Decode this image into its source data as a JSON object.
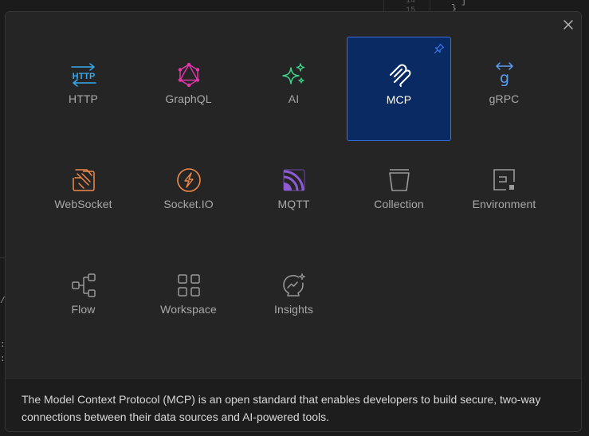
{
  "background": {
    "line_numbers": [
      "14",
      "15"
    ],
    "code_lines": [
      "]",
      "}"
    ],
    "left_marks": [
      ":",
      ":",
      "/"
    ]
  },
  "modal": {
    "close_label": "×",
    "tiles": [
      {
        "label": "HTTP",
        "icon": "http-icon",
        "color": "#3aa8e8"
      },
      {
        "label": "GraphQL",
        "icon": "graphql-icon",
        "color": "#e535ab"
      },
      {
        "label": "AI",
        "icon": "sparkles-icon",
        "color": "#3dd68c"
      },
      {
        "label": "MCP",
        "icon": "mcp-icon",
        "color": "#ffffff",
        "active": true
      },
      {
        "label": "gRPC",
        "icon": "grpc-icon",
        "color": "#5b9df5"
      },
      {
        "label": "WebSocket",
        "icon": "websocket-icon",
        "color": "#f08a4b"
      },
      {
        "label": "Socket.IO",
        "icon": "socketio-icon",
        "color": "#f08a4b"
      },
      {
        "label": "MQTT",
        "icon": "mqtt-icon",
        "color": "#8f5bd4"
      },
      {
        "label": "Collection",
        "icon": "collection-icon",
        "color": "#9a9a9a"
      },
      {
        "label": "Environment",
        "icon": "environment-icon",
        "color": "#9a9a9a"
      },
      {
        "label": "Flow",
        "icon": "flow-icon",
        "color": "#9a9a9a"
      },
      {
        "label": "Workspace",
        "icon": "workspace-icon",
        "color": "#9a9a9a"
      },
      {
        "label": "Insights",
        "icon": "insights-icon",
        "color": "#9a9a9a"
      }
    ],
    "description": "The Model Context Protocol (MCP) is an open standard that enables developers to build secure, two-way connections between their data sources and AI-powered tools."
  }
}
